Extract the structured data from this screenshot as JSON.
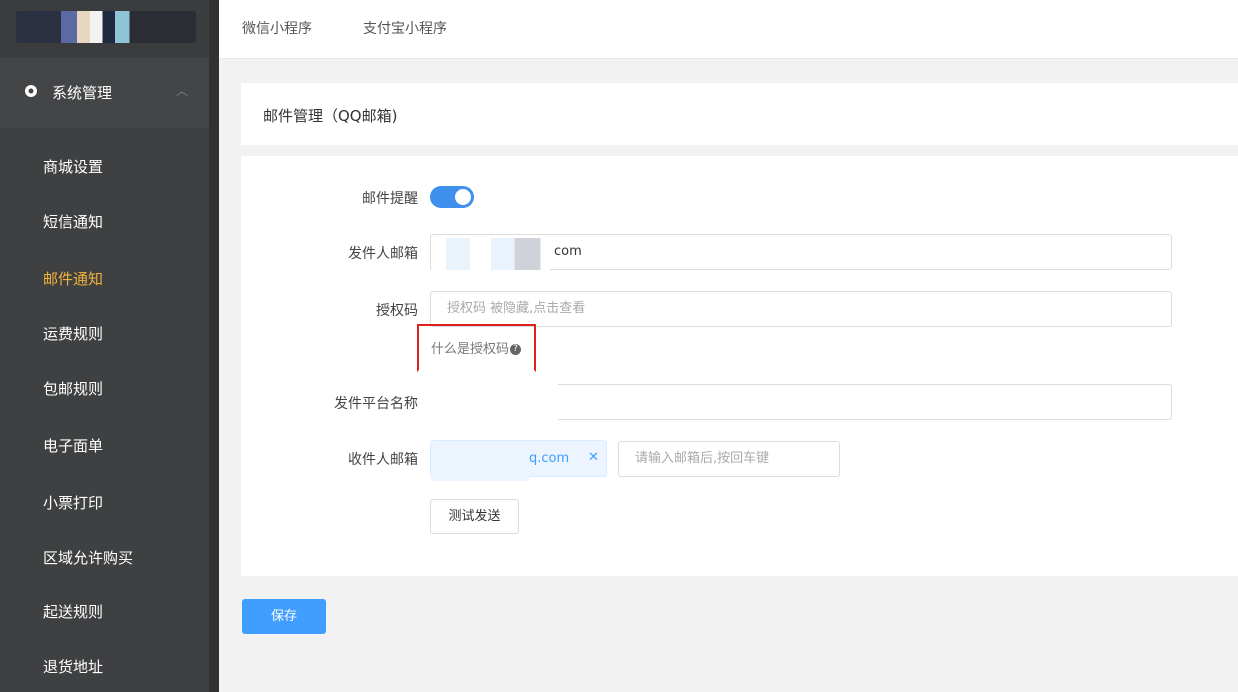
{
  "sidebar": {
    "group_title": "系统管理",
    "items": [
      {
        "label": "商城设置",
        "active": false
      },
      {
        "label": "短信通知",
        "active": false
      },
      {
        "label": "邮件通知",
        "active": true
      },
      {
        "label": "运费规则",
        "active": false
      },
      {
        "label": "包邮规则",
        "active": false
      },
      {
        "label": "电子面单",
        "active": false
      },
      {
        "label": "小票打印",
        "active": false
      },
      {
        "label": "区域允许购买",
        "active": false
      },
      {
        "label": "起送规则",
        "active": false
      },
      {
        "label": "退货地址",
        "active": false
      }
    ]
  },
  "tabs": [
    "微信小程序",
    "支付宝小程序"
  ],
  "card": {
    "title": "邮件管理（QQ邮箱)"
  },
  "form": {
    "email_alert_label": "邮件提醒",
    "email_alert_on": true,
    "sender_email_label": "发件人邮箱",
    "sender_email_value": "com",
    "auth_code_label": "授权码",
    "auth_code_placeholder": "授权码 被隐藏,点击查看",
    "auth_help": "什么是授权码",
    "platform_label": "发件平台名称",
    "platform_value": "",
    "recipient_label": "收件人邮箱",
    "recipient_tag": "q.com",
    "recipient_placeholder": "请输入邮箱后,按回车键",
    "test_send": "测试发送"
  },
  "save": "保存",
  "colors": {
    "primary": "#409eff",
    "sidebar": "#3e4042",
    "active": "#f1b33b",
    "highlight": "#e02020"
  }
}
